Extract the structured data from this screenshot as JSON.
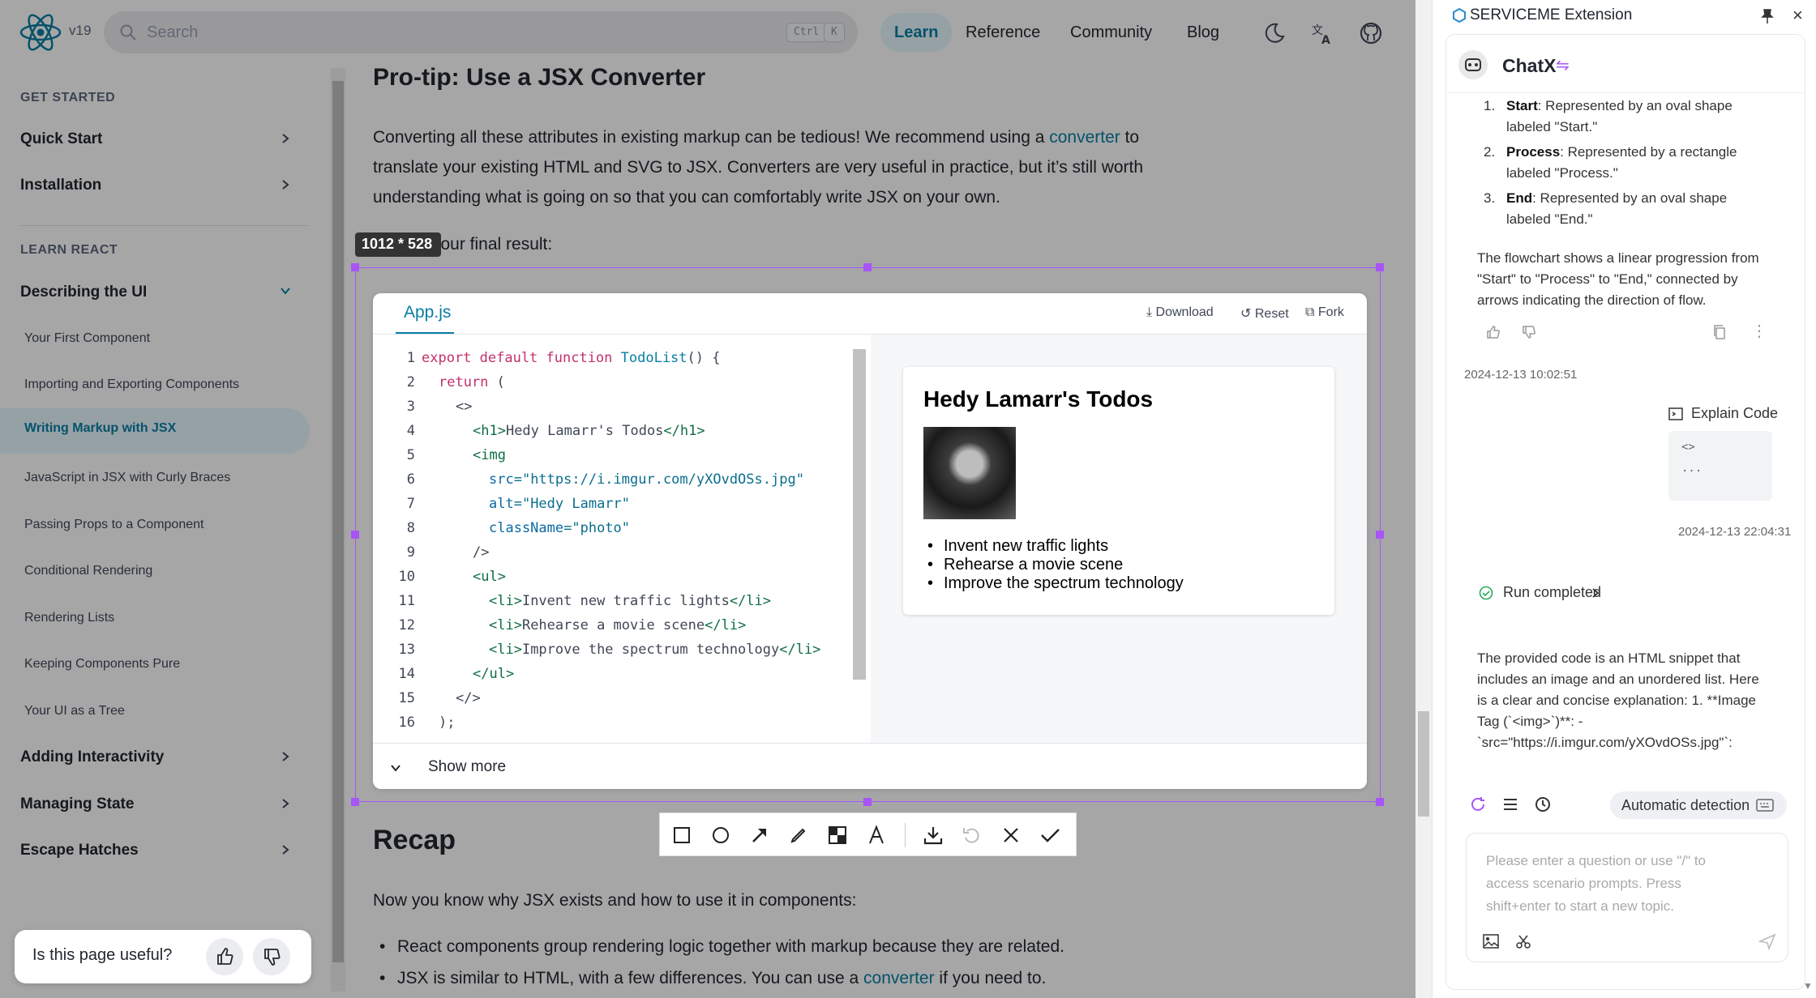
{
  "header": {
    "version": "v19",
    "search_placeholder": "Search",
    "kbd": [
      "Ctrl",
      "K"
    ],
    "nav": [
      "Learn",
      "Reference",
      "Community",
      "Blog"
    ]
  },
  "sidebar": {
    "get_started": "GET STARTED",
    "items_top": [
      "Quick Start",
      "Installation"
    ],
    "learn_react": "LEARN REACT",
    "describing": "Describing the UI",
    "sub": [
      "Your First Component",
      "Importing and Exporting Components",
      "Writing Markup with JSX",
      "JavaScript in JSX with Curly Braces",
      "Passing Props to a Component",
      "Conditional Rendering",
      "Rendering Lists",
      "Keeping Components Pure",
      "Your UI as a Tree"
    ],
    "items_bottom": [
      "Adding Interactivity",
      "Managing State",
      "Escape Hatches"
    ],
    "useful": "Is this page useful?"
  },
  "article": {
    "protip_title": "Pro-tip: Use a JSX Converter",
    "p1_a": "Converting all these attributes in existing markup can be tedious! We recommend using a ",
    "p1_link": "converter",
    "p1_b": " to",
    "p1_line2": "translate your existing HTML and SVG to JSX. Converters are very useful in practice, but it’s still worth",
    "p1_line3": "understanding what is going on so that you can comfortably write JSX on your own.",
    "final": "your final result:",
    "recap_title": "Recap",
    "recap_p": "Now you know why JSX exists and how to use it in components:",
    "recap_li1": "React components group rendering logic together with markup because they are related.",
    "recap_li2_a": "JSX is similar to HTML, with a few differences. You can use a ",
    "recap_li2_link": "converter",
    "recap_li2_b": " if you need to."
  },
  "sandbox": {
    "tab": "App.js",
    "actions": [
      "Download",
      "Reset",
      "Fork"
    ],
    "line_numbers": [
      "1",
      "2",
      "3",
      "4",
      "5",
      "6",
      "7",
      "8",
      "9",
      "10",
      "11",
      "12",
      "13",
      "14",
      "15",
      "16"
    ],
    "code": {
      "l1_kw": "export default function ",
      "l1_fn": "TodoList",
      "l1_rest": "() {",
      "l2_kw": "return",
      "l2_rest": " (",
      "l3": "<>",
      "l4_tag": "<h1>",
      "l4_text": "Hedy Lamarr's Todos",
      "l4_close": "</h1>",
      "l5": "<img",
      "l6_attr": "src",
      "l6_val": "=\"https://i.imgur.com/yXOvdOSs.jpg\"",
      "l7_attr": "alt",
      "l7_val": "=\"Hedy Lamarr\"",
      "l8_attr": "className",
      "l8_val": "=\"photo\"",
      "l9": "/>",
      "l10": "<ul>",
      "l11_a": "<li>",
      "l11_t": "Invent new traffic lights",
      "l11_b": "</li>",
      "l12_a": "<li>",
      "l12_t": "Rehearse a movie scene",
      "l12_b": "</li>",
      "l13_a": "<li>",
      "l13_t": "Improve the spectrum technology",
      "l13_b": "</li>",
      "l14": "</ul>",
      "l15": "</>",
      "l16": ");"
    },
    "preview": {
      "title": "Hedy Lamarr's Todos",
      "items": [
        "Invent new traffic lights",
        "Rehearse a movie scene",
        "Improve the spectrum technology"
      ]
    },
    "show_more": "Show more"
  },
  "capture": {
    "dimensions": "1012 * 528"
  },
  "panel": {
    "title": "SERVICEME Extension",
    "bot_name": "ChatX",
    "list": [
      {
        "n": "1.",
        "b": "Start",
        "t": ": Represented by an oval shape",
        "t2": "labeled \"Start.\""
      },
      {
        "n": "2.",
        "b": "Process",
        "t": ": Represented by a rectangle",
        "t2": "labeled \"Process.\""
      },
      {
        "n": "3.",
        "b": "End",
        "t": ": Represented by an oval shape",
        "t2": "labeled \"End.\""
      }
    ],
    "summary": [
      "The flowchart shows a linear progression from",
      "\"Start\" to \"Process\" to \"End,\" connected by",
      "arrows indicating the direction of flow."
    ],
    "ts1": "2024-12-13 10:02:51",
    "explain": "Explain Code",
    "explain_code": [
      "<>",
      "..."
    ],
    "ts2": "2024-12-13 22:04:31",
    "run": "Run completed",
    "reply": [
      "The provided code is an HTML snippet that",
      "includes an image and an unordered list. Here",
      "is a clear and concise explanation: 1. **Image",
      "Tag (`<img>`)**: -",
      "`src=\"https://i.imgur.com/yXOvdOSs.jpg\"`:"
    ],
    "auto": "Automatic detection",
    "input_placeholder": "Please enter a question or use \"/\" to access scenario prompts. Press shift+enter to start a new topic."
  }
}
